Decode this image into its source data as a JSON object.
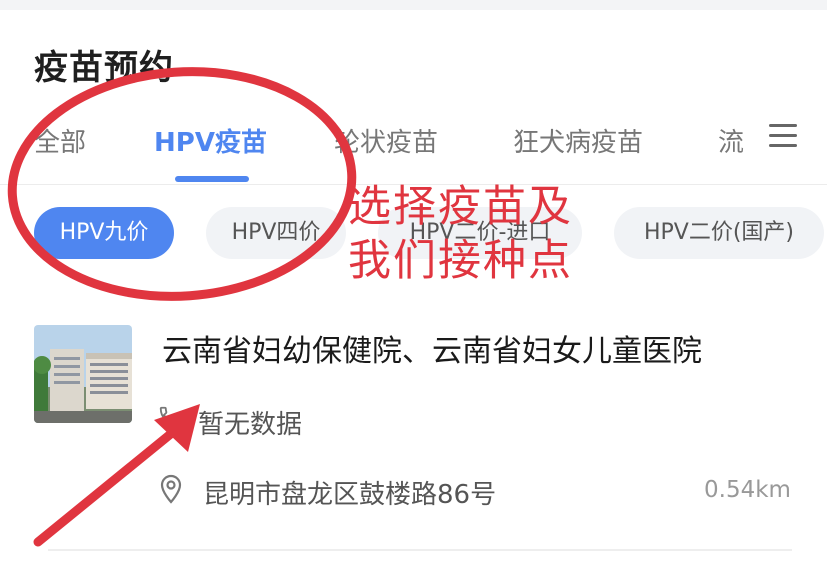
{
  "page": {
    "title": "疫苗预约"
  },
  "tabs": [
    {
      "label": "全部",
      "active": false
    },
    {
      "label": "HPV疫苗",
      "active": true
    },
    {
      "label": "轮状疫苗",
      "active": false
    },
    {
      "label": "狂犬病疫苗",
      "active": false
    },
    {
      "label": "流",
      "active": false
    }
  ],
  "chips": [
    {
      "label": "HPV九价",
      "active": true
    },
    {
      "label": "HPV四价",
      "active": false
    },
    {
      "label": "HPV二价-进口",
      "active": false
    },
    {
      "label": "HPV二价(国产)",
      "active": false
    }
  ],
  "hospital": {
    "name": "云南省妇幼保健院、云南省妇女儿童医院",
    "phone_text": "暂无数据",
    "address": "昆明市盘龙区鼓楼路86号",
    "distance": "0.54km"
  },
  "annotation": {
    "line1": "选择疫苗及",
    "line2": "我们接种点",
    "color": "#e0353f"
  },
  "colors": {
    "accent": "#4f86f0",
    "annotation": "#e0353f"
  },
  "icons": {
    "menu": "menu-icon",
    "phone": "phone-icon",
    "location": "location-pin-icon"
  }
}
